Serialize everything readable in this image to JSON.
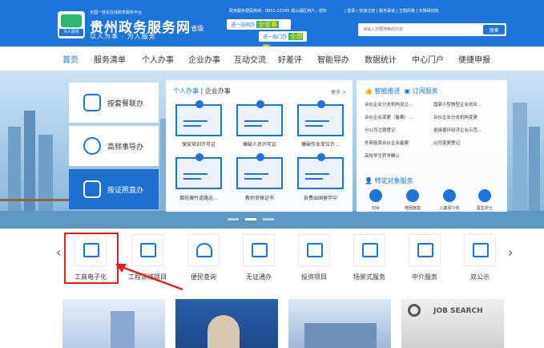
{
  "header": {
    "tagline_small": "全国一体化在线政务服务平台",
    "title": "贵州政务服务网",
    "slogan": "以人为本 · 为人服务",
    "logo_badge": "为人服务",
    "location": "省级",
    "motto1_a": "进一张网办",
    "motto1_b": "全省事",
    "motto2_a": "进一扇门办",
    "motto2_b": "全部事",
    "hotline": "政务服务便民热线：0851-12345  观山湖区用户，您好",
    "toplinks": "| 登录 | 快速注册 | 服务渠道 | 主题风格 | 无障碍浏览",
    "search_placeholder": "请输入您要搜索的内容",
    "search_button": "搜索"
  },
  "nav": {
    "items": [
      "首页",
      "服务清单",
      "个人办事",
      "企业办事",
      "互动交流",
      "好差评",
      "智能导办",
      "数据统计",
      "中心门户",
      "便捷申报"
    ]
  },
  "quick": {
    "items": [
      "按套餐联办",
      "高频事导办",
      "按证照直办"
    ]
  },
  "panel": {
    "tab1": "个人办事",
    "sep": "|",
    "tab2": "企业办事",
    "more": "更多 >",
    "cards": [
      "保安培训许可证",
      "爆破人员许可证",
      "爆破作业单位许…",
      "烟花爆竹道路运…",
      "教师资格证书",
      "自费出国留学中"
    ]
  },
  "right_panel": {
    "tab1": "智能推送",
    "tab2": "订阅服务",
    "links": [
      "合伙企业分支机构设立…",
      "国家小型微型企业创业…",
      "合伙企业变更（备案）…",
      "合伙企业分支机构变更",
      "分公司注销登记",
      "省级循环经济企业示范…",
      "外商投资合伙企业备案",
      "公司变更登记",
      "高校学生转学确认"
    ],
    "sub_title": "特定对象服务",
    "targets": [
      "妇女",
      "特困家庭",
      "儿童青少年",
      "医生护士"
    ]
  },
  "services": {
    "items": [
      "工商电子化",
      "工程领域项目",
      "便民查询",
      "无证通办",
      "投资项目",
      "场景式服务",
      "中介服务",
      "双公示"
    ]
  },
  "thumbs": {
    "job_search": "JOB SEARCH"
  },
  "colors": {
    "brand": "#1e75d9",
    "accent_green": "#2bb673",
    "highlight_red": "#e02020"
  }
}
